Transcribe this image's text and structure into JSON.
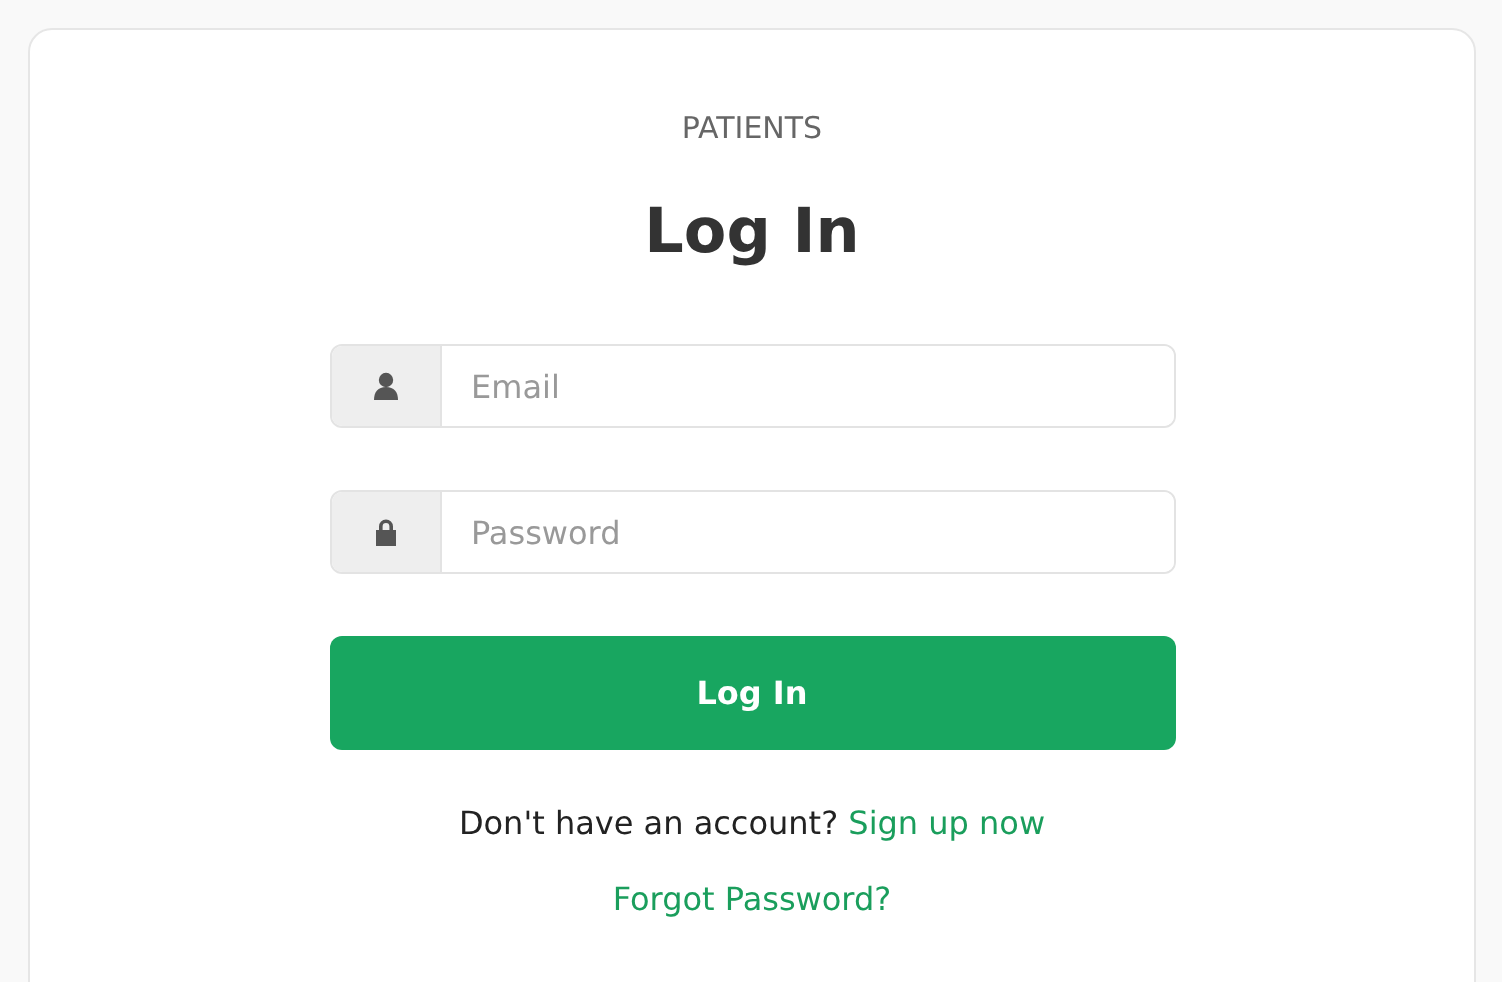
{
  "section_label": "PATIENTS",
  "title": "Log In",
  "fields": [
    {
      "kind": "email",
      "placeholder": "Email"
    },
    {
      "kind": "password",
      "placeholder": "Password"
    }
  ],
  "submit_button": "Log In",
  "signup_prompt": {
    "text": "Don't have an account?",
    "link": "Sign up now"
  },
  "forgot_link": "Forgot Password?"
}
